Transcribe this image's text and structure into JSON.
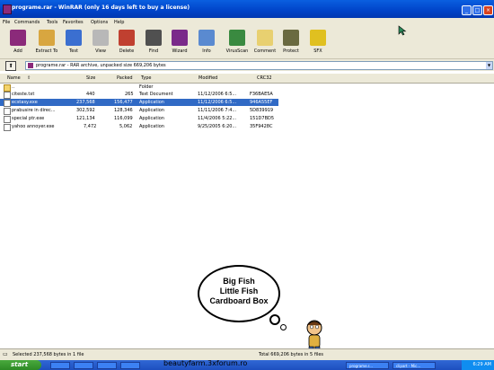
{
  "window": {
    "title": "programe.rar - WinRAR (only 16 days left to buy a license)",
    "minimize": "_",
    "maximize": "□",
    "close": "×"
  },
  "menu": [
    "File",
    "Commands",
    "Tools",
    "Favorites",
    "Options",
    "Help"
  ],
  "toolbar": [
    {
      "label": "Add",
      "icon": "add-icon",
      "color": "#8b2a7a"
    },
    {
      "label": "Extract To",
      "icon": "extract-icon",
      "color": "#d8a640"
    },
    {
      "label": "Test",
      "icon": "test-icon",
      "color": "#3b6fd0"
    },
    {
      "label": "View",
      "icon": "view-icon",
      "color": "#b8b8b8"
    },
    {
      "label": "Delete",
      "icon": "delete-icon",
      "color": "#c04030"
    },
    {
      "label": "Find",
      "icon": "find-icon",
      "color": "#505050"
    },
    {
      "label": "Wizard",
      "icon": "wizard-icon",
      "color": "#7a2a8a"
    },
    {
      "label": "Info",
      "icon": "info-icon",
      "color": "#5a8ad0"
    },
    {
      "label": "VirusScan",
      "icon": "virusscan-icon",
      "color": "#3a8a40"
    },
    {
      "label": "Comment",
      "icon": "comment-icon",
      "color": "#e8d070"
    },
    {
      "label": "Protect",
      "icon": "protect-icon",
      "color": "#6a6a40"
    },
    {
      "label": "SFX",
      "icon": "sfx-icon",
      "color": "#e0c020"
    }
  ],
  "address": {
    "up": "⬆",
    "text": "programe.rar - RAR archive, unpacked size 669,206 bytes",
    "dropdown": "▼"
  },
  "columns": {
    "name": "Name",
    "sort": "⇧",
    "size": "Size",
    "packed": "Packed",
    "type": "Type",
    "modified": "Modified",
    "crc": "CRC32"
  },
  "files": [
    {
      "name": "..",
      "size": "",
      "packed": "",
      "type": "Folder",
      "modified": "",
      "crc": "",
      "kind": "folder",
      "selected": false
    },
    {
      "name": "citeste.txt",
      "size": "440",
      "packed": "265",
      "type": "Text Document",
      "modified": "11/12/2006 6:5...",
      "crc": "F36BAE5A",
      "kind": "file",
      "selected": false
    },
    {
      "name": "ecstasy.exe",
      "size": "237,568",
      "packed": "156,477",
      "type": "Application",
      "modified": "11/12/2006 6:5...",
      "crc": "946A55EF",
      "kind": "file",
      "selected": true
    },
    {
      "name": "prabusire in direc...",
      "size": "302,592",
      "packed": "128,346",
      "type": "Application",
      "modified": "11/11/2006 7:4...",
      "crc": "5D839919",
      "kind": "file",
      "selected": false
    },
    {
      "name": "special ptr.exe",
      "size": "121,134",
      "packed": "116,099",
      "type": "Application",
      "modified": "11/4/2006 5:22...",
      "crc": "151D7BD5",
      "kind": "file",
      "selected": false
    },
    {
      "name": "yahoo annoyer.exe",
      "size": "7,472",
      "packed": "5,062",
      "type": "Application",
      "modified": "9/25/2005 6:20...",
      "crc": "35F9428C",
      "kind": "file",
      "selected": false
    }
  ],
  "status": {
    "left": "Selected 237,568 bytes in 1 file",
    "right": "Total 669,206 bytes in 5 files"
  },
  "taskbar": {
    "start": "start",
    "tasks": [
      "",
      "",
      "",
      "",
      "programe.r...",
      "clipart - Mic..."
    ],
    "clock": "6:29 AM"
  },
  "watermark": "beautyfarm.3xforum.ro",
  "bubble": [
    "Big Fish",
    "Little Fish",
    "Cardboard Box"
  ]
}
